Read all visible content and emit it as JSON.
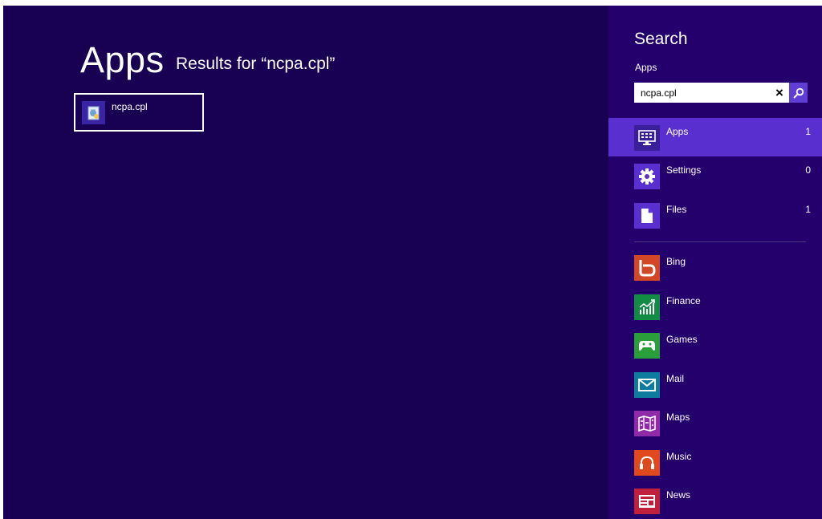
{
  "results": {
    "heading": "Apps",
    "subheading": "Results for “ncpa.cpl”",
    "items": [
      {
        "label": "ncpa.cpl",
        "icon": "control-panel-applet-icon"
      }
    ]
  },
  "search_pane": {
    "title": "Search",
    "scope_label": "Apps",
    "input_value": "ncpa.cpl",
    "clear_icon": "×",
    "scopes": [
      {
        "label": "Apps",
        "count": "1",
        "icon": "apps-icon",
        "selected": true
      },
      {
        "label": "Settings",
        "count": "0",
        "icon": "gear-icon",
        "selected": false
      },
      {
        "label": "Files",
        "count": "1",
        "icon": "file-icon",
        "selected": false
      }
    ],
    "apps": [
      {
        "label": "Bing",
        "icon": "bing-icon",
        "color": "#d24726"
      },
      {
        "label": "Finance",
        "icon": "finance-icon",
        "color": "#128b44"
      },
      {
        "label": "Games",
        "icon": "games-icon",
        "color": "#2a9e3a"
      },
      {
        "label": "Mail",
        "icon": "mail-icon",
        "color": "#0d7c9f"
      },
      {
        "label": "Maps",
        "icon": "maps-icon",
        "color": "#8f2aa8"
      },
      {
        "label": "Music",
        "icon": "music-icon",
        "color": "#e0491d"
      },
      {
        "label": "News",
        "icon": "news-icon",
        "color": "#c1203d"
      }
    ]
  },
  "colors": {
    "background": "#180052",
    "pane": "#23006c",
    "selected": "#5a2fd0",
    "accent": "#5f3ed6"
  }
}
